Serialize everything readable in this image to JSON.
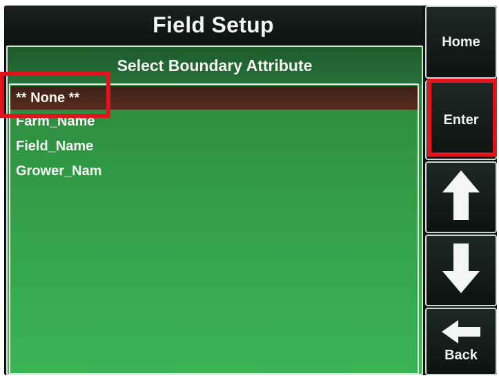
{
  "header": {
    "title": "Field Setup"
  },
  "panel": {
    "subtitle": "Select Boundary Attribute"
  },
  "list": {
    "selected_index": 0,
    "items": [
      {
        "label": "** None **"
      },
      {
        "label": "Farm_Name"
      },
      {
        "label": "Field_Name"
      },
      {
        "label": "Grower_Nam"
      }
    ]
  },
  "sidebar": {
    "home_label": "Home",
    "enter_label": "Enter",
    "up_icon": "arrow-up-icon",
    "down_icon": "arrow-down-icon",
    "back_icon": "arrow-left-icon",
    "back_label": "Back"
  },
  "colors": {
    "highlight": "#e0141c",
    "list_green": "#33a24a",
    "selected_row": "#4a2619"
  }
}
